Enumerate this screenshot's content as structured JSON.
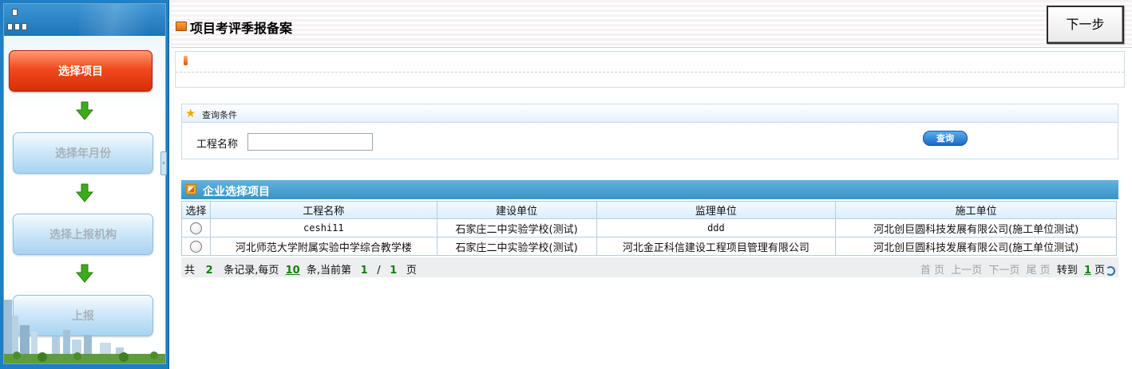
{
  "wizard": {
    "steps": [
      {
        "label": "选择项目",
        "state": "active"
      },
      {
        "label": "选择年月份",
        "state": "inactive"
      },
      {
        "label": "选择上报机构",
        "state": "inactive"
      },
      {
        "label": "上报",
        "state": "inactive"
      }
    ],
    "splitter_glyph": "‹"
  },
  "header": {
    "title": "项目考评季报备案",
    "next_button": "下一步"
  },
  "query": {
    "section_label": "查询条件",
    "field_label": "工程名称",
    "field_value": "",
    "field_placeholder": "",
    "search_button": "查询"
  },
  "grid": {
    "title": "企业选择项目",
    "columns": [
      "选择",
      "工程名称",
      "建设单位",
      "监理单位",
      "施工单位"
    ],
    "rows": [
      {
        "name": "ceshi11",
        "builder": "石家庄二中实验学校(测试)",
        "supervisor": "ddd",
        "constructor": "河北创巨圆科技发展有限公司(施工单位测试)"
      },
      {
        "name": "河北师范大学附属实验中学综合教学楼",
        "builder": "石家庄二中实验学校(测试)",
        "supervisor": "河北金正科信建设工程项目管理有限公司",
        "constructor": "河北创巨圆科技发展有限公司(施工单位测试)"
      }
    ]
  },
  "pager": {
    "total_prefix": "共",
    "total": "2",
    "per_page_prefix": "条记录,每页",
    "per_page": "10",
    "current_prefix": "条,当前第",
    "current": "1",
    "slash": "/",
    "pages": "1",
    "page_suffix": "页",
    "first": "首 页",
    "prev": "上一页",
    "next": "下一页",
    "last": "尾 页",
    "goto_label": "转到",
    "goto_value": "1",
    "goto_suffix": "页"
  },
  "colors": {
    "active_step": "#f04a1e",
    "inactive_step": "#cfe8f8",
    "grid_header": "#3b93c5",
    "pager_number": "#12810c"
  }
}
